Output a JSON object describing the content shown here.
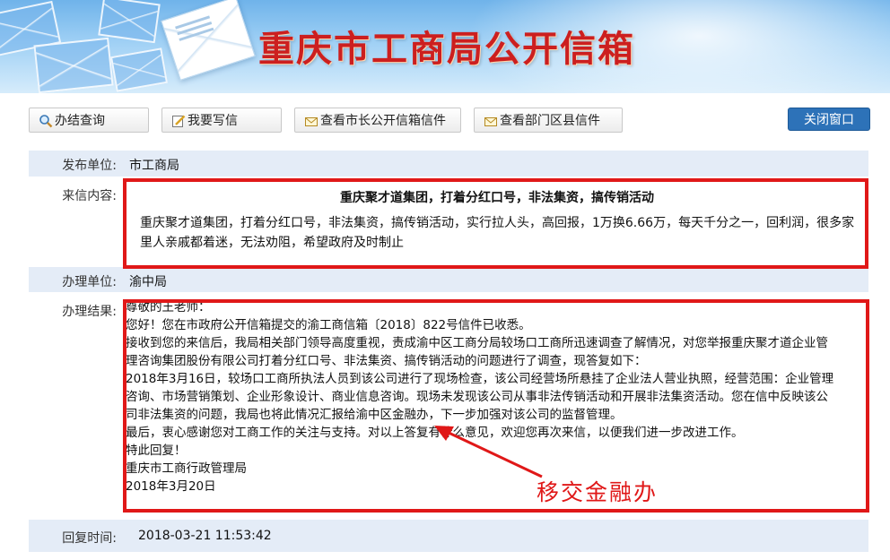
{
  "header": {
    "title": "重庆市工商局公开信箱"
  },
  "toolbar": {
    "query": "办结查询",
    "write": "我要写信",
    "mayor": "查看市长公开信箱信件",
    "district": "查看部门区县信件",
    "close": "关闭窗口"
  },
  "record": {
    "publisher_label": "发布单位:",
    "publisher": "市工商局",
    "content_label": "来信内容:",
    "letter_title": "重庆聚才道集团，打着分红口号，非法集资，搞传销活动",
    "letter_line1": "重庆聚才道集团，打着分红口号，非法集资，搞传销活动，实行拉人头，高回报，1万换6.66万，每天千分之一，回利润，很多家",
    "letter_line2": "里人亲戚都着迷，无法劝阻，希望政府及时制止",
    "handler_label": "办理单位:",
    "handler": "渝中局",
    "result_label": "办理结果:",
    "result_lines": [
      "尊敬的王老师：",
      "您好！您在市政府公开信箱提交的渝工商信箱〔2018〕822号信件已收悉。",
      "接收到您的来信后，我局相关部门领导高度重视，责成渝中区工商分局较场口工商所迅速调查了解情况，对您举报重庆聚才道企业管",
      "理咨询集团股份有限公司打着分红口号、非法集资、搞传销活动的问题进行了调查，现答复如下：",
      "2018年3月16日，较场口工商所执法人员到该公司进行了现场检查，该公司经营场所悬挂了企业法人营业执照，经营范围：企业管理",
      "咨询、市场营销策划、企业形象设计、商业信息咨询。现场未发现该公司从事非法传销活动和开展非法集资活动。您在信中反映该公",
      "司非法集资的问题，我局也将此情况汇报给渝中区金融办，下一步加强对该公司的监督管理。",
      "最后，衷心感谢您对工商工作的关注与支持。对以上答复有什么意见，欢迎您再次来信，以便我们进一步改进工作。",
      "特此回复！",
      "重庆市工商行政管理局",
      "2018年3月20日"
    ],
    "reply_time_label": "回复时间:",
    "reply_time": "2018-03-21 11:53:42"
  },
  "annotation": {
    "text": "移交金融办",
    "color": "#e01818"
  },
  "colors": {
    "accent": "#2d72b8",
    "row_shade": "#e4ecf7",
    "title_red": "#cc1f1f"
  }
}
